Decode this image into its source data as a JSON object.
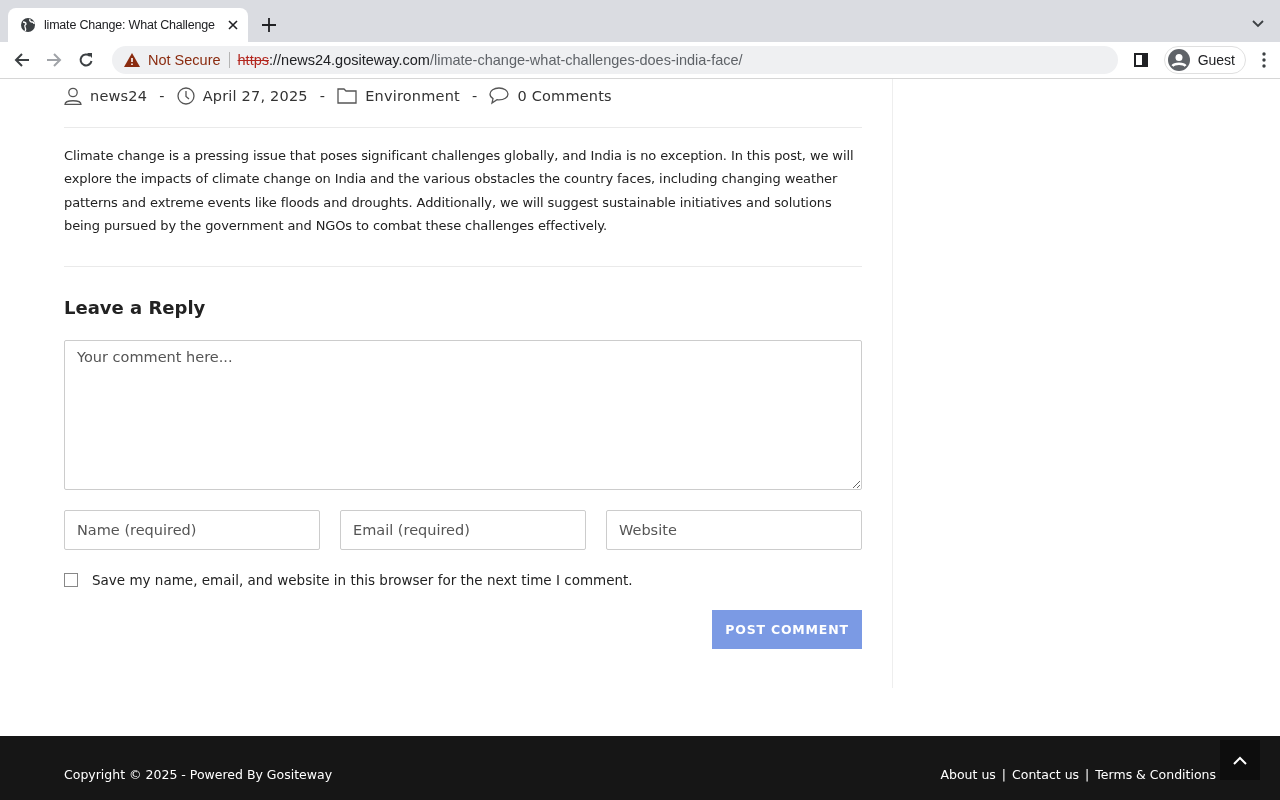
{
  "browser": {
    "tabs": [
      {
        "title": "limate Change: What Challenge",
        "selected": true
      }
    ],
    "address": {
      "security": "Not Secure",
      "scheme": "https",
      "host": "://news24.gositeway.com",
      "path": "/limate-change-what-challenges-does-india-face/"
    },
    "profile": "Guest"
  },
  "post": {
    "meta": [
      {
        "kind": "author",
        "text": "news24"
      },
      {
        "kind": "date",
        "text": "April 27, 2025"
      },
      {
        "kind": "category",
        "text": "Environment"
      },
      {
        "kind": "comments",
        "text": "0 Comments"
      }
    ],
    "separator": "-",
    "excerpt": "Climate change is a pressing issue that poses significant challenges globally, and India is no exception. In this post, we will explore the impacts of climate change on India and the various obstacles the country faces, including changing weather patterns and extreme events like floods and droughts. Additionally, we will suggest sustainable initiatives and solutions being pursued by the government and NGOs to combat these challenges effectively."
  },
  "reply": {
    "heading": "Leave a Reply",
    "comment_placeholder": "Your comment here...",
    "fields": [
      {
        "placeholder": "Name (required)"
      },
      {
        "placeholder": "Email (required)"
      },
      {
        "placeholder": "Website"
      }
    ],
    "save_info": {
      "label": "Save my name, email, and website in this browser for the next time I comment.",
      "checked": false
    },
    "submit": "POST COMMENT"
  },
  "footer": {
    "copyright": "Copyright © 2025 - Powered By Gositeway",
    "links": [
      "About us",
      "Contact us",
      "Terms & Conditions"
    ],
    "link_separator": "|"
  }
}
